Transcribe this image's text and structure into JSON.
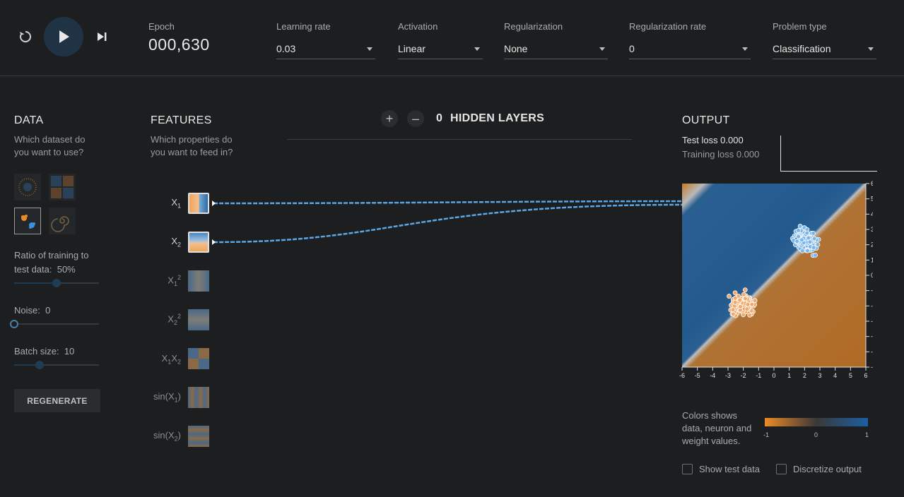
{
  "controls": {
    "reset_icon": "reset-icon",
    "play_icon": "play-icon",
    "step_icon": "step-forward-icon"
  },
  "header": {
    "epoch_label": "Epoch",
    "epoch_value": "000,630",
    "learning_rate": {
      "label": "Learning rate",
      "value": "0.03"
    },
    "activation": {
      "label": "Activation",
      "value": "Linear"
    },
    "regularization": {
      "label": "Regularization",
      "value": "None"
    },
    "regularization_rate": {
      "label": "Regularization rate",
      "value": "0"
    },
    "problem_type": {
      "label": "Problem type",
      "value": "Classification"
    }
  },
  "data": {
    "title": "DATA",
    "subtitle_line1": "Which dataset do",
    "subtitle_line2": "you want to use?",
    "ratio_label": "Ratio of training to",
    "ratio_label2": "test data:",
    "ratio_value": "50%",
    "ratio_fraction": 0.5,
    "noise_label": "Noise:",
    "noise_value": "0",
    "noise_fraction": 0,
    "batch_label": "Batch size:",
    "batch_value": "10",
    "batch_fraction": 0.3,
    "regenerate_label": "REGENERATE"
  },
  "features": {
    "title": "FEATURES",
    "subtitle_line1": "Which properties do",
    "subtitle_line2": "you want to feed in?"
  },
  "network": {
    "hidden_count": "0",
    "hidden_title": "HIDDEN LAYERS",
    "add_label": "+",
    "remove_label": "–"
  },
  "output": {
    "title": "OUTPUT",
    "test_loss": "Test loss 0.000",
    "training_loss": "Training loss 0.000",
    "x_ticks": [
      "-6",
      "-5",
      "-4",
      "-3",
      "-2",
      "-1",
      "0",
      "1",
      "2",
      "3",
      "4",
      "5",
      "6"
    ],
    "y_ticks": [
      "6",
      "5",
      "4",
      "3",
      "2",
      "1",
      "0",
      "-1",
      "-2",
      "-3",
      "-4",
      "-5",
      "-6"
    ],
    "legend_line1": "Colors shows",
    "legend_line2": "data, neuron and",
    "legend_line3": "weight values.",
    "legend_min": "-1",
    "legend_mid": "0",
    "legend_max": "1",
    "show_test_label": "Show test data",
    "discretize_label": "Discretize output"
  },
  "colors": {
    "orange": "#ee8a26",
    "blue": "#1b5fa3",
    "link": "#5aa7e8"
  }
}
